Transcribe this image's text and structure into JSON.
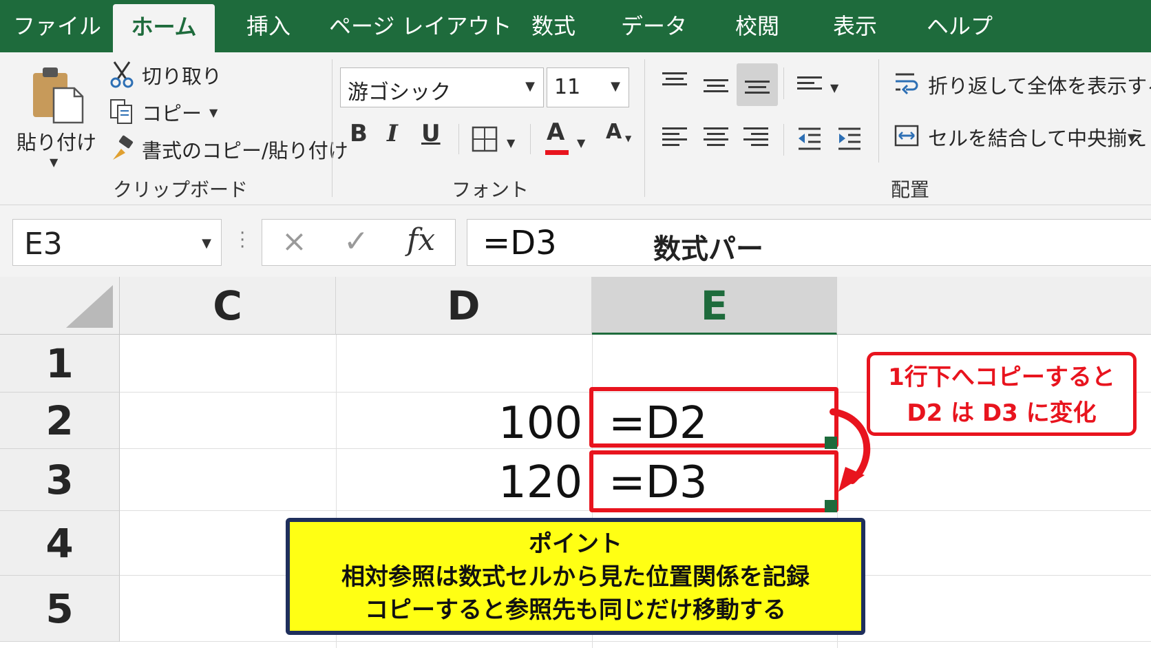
{
  "tabs": [
    {
      "label": "ファイル",
      "active": false
    },
    {
      "label": "ホーム",
      "active": true
    },
    {
      "label": "挿入",
      "active": false
    },
    {
      "label": "ページ レイアウト",
      "active": false
    },
    {
      "label": "数式",
      "active": false
    },
    {
      "label": "データ",
      "active": false
    },
    {
      "label": "校閲",
      "active": false
    },
    {
      "label": "表示",
      "active": false
    },
    {
      "label": "ヘルプ",
      "active": false
    }
  ],
  "clipboard": {
    "paste_label": "貼り付け",
    "cut_label": "切り取り",
    "copy_label": "コピー",
    "format_painter_label": "書式のコピー/貼り付け",
    "group_label": "クリップボード"
  },
  "font": {
    "font_name": "游ゴシック",
    "font_size": "11",
    "bold_label": "B",
    "italic_label": "I",
    "underline_label": "U",
    "font_color_label": "A",
    "shrink_label": "A",
    "group_label": "フォント"
  },
  "alignment": {
    "wrap_label": "折り返して全体を表示する",
    "merge_label": "セルを結合して中央揃え",
    "group_label": "配置"
  },
  "formula_bar": {
    "name_box": "E3",
    "cancel_symbol": "×",
    "enter_symbol": "✓",
    "fx_label": "fx",
    "content": "=D3",
    "trailing_text": "数式パー"
  },
  "grid": {
    "columns": [
      "C",
      "D",
      "E"
    ],
    "selected_column": "E",
    "rows": [
      "1",
      "2",
      "3",
      "4",
      "5"
    ],
    "d_values": {
      "row2": "100",
      "row3": "120"
    },
    "e_formulas": {
      "row2": "=D2",
      "row3": "=D3"
    }
  },
  "callout": {
    "line1": "1行下へコピーすると",
    "line2": "D2 は D3 に変化"
  },
  "note": {
    "title": "ポイント",
    "line1": "相対参照は数式セルから見た位置関係を記録",
    "line2": "コピーすると参照先も同じだけ移動する"
  },
  "colors": {
    "excel_green": "#1e6b3c",
    "highlight_red": "#e8141e",
    "note_yellow": "#ffff14",
    "note_border": "#1f2f5c"
  }
}
